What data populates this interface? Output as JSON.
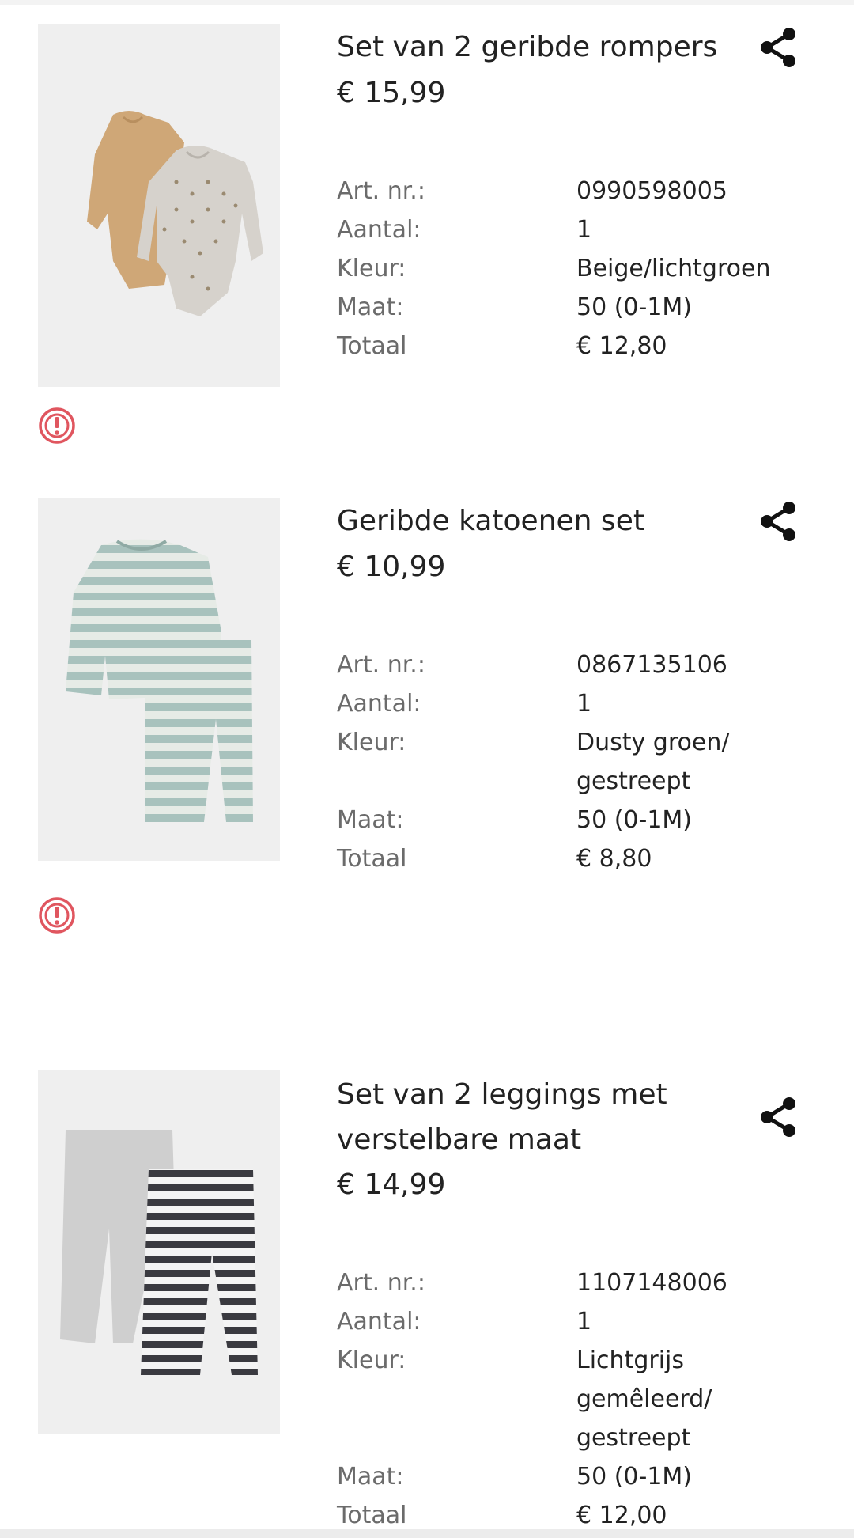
{
  "labels": {
    "art_nr": "Art. nr.:",
    "aantal": "Aantal:",
    "kleur": "Kleur:",
    "maat": "Maat:",
    "totaal": "Totaal"
  },
  "items": [
    {
      "title": "Set van 2 geribde rompers",
      "price": "€ 15,99",
      "art_nr": "0990598005",
      "aantal": "1",
      "kleur": "Beige/lichtgroen",
      "maat": "50 (0-1M)",
      "totaal": "€ 12,80",
      "image_icon": "rompers-image"
    },
    {
      "title": "Geribde katoenen set",
      "price": "€ 10,99",
      "art_nr": "0867135106",
      "aantal": "1",
      "kleur": "Dusty groen/ gestreept",
      "maat": "50 (0-1M)",
      "totaal": "€ 8,80",
      "image_icon": "striped-set-image"
    },
    {
      "title": "Set van 2 leggings met verstelbare maat",
      "price": "€ 14,99",
      "art_nr": "1107148006",
      "aantal": "1",
      "kleur": "Lichtgrijs gemêleerd/ gestreept",
      "maat": "50 (0-1M)",
      "totaal": "€ 12,00",
      "image_icon": "leggings-image"
    }
  ],
  "icons": {
    "share": "share-icon",
    "warning": "warning-icon"
  },
  "colors": {
    "warning": "#e0565f",
    "text": "#222222",
    "label": "#6b6b6b"
  }
}
